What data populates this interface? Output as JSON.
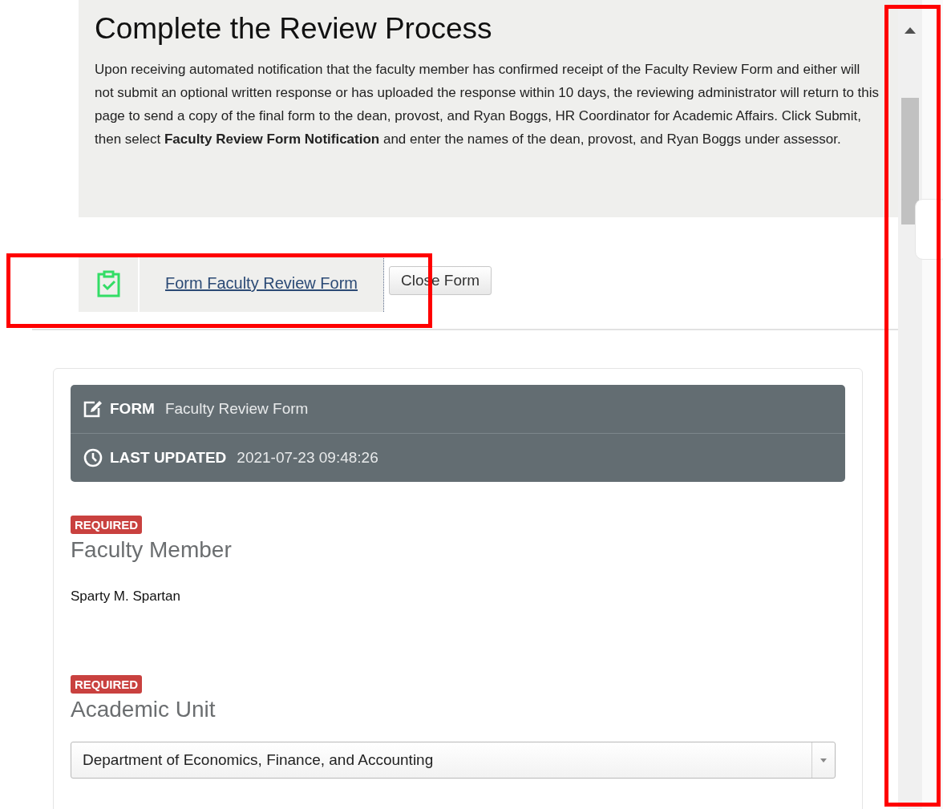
{
  "instructions": {
    "title": "Complete the Review Process",
    "text": "Upon receiving automated notification that the faculty member has confirmed receipt of the Faculty Review Form and either will not submit an optional written response or has uploaded the response within 10 days, the reviewing administrator will return to this page to send a copy of the final form to the dean, provost, and Ryan Boggs, HR Coordinator for Academic Affairs. Click Submit, then select **Faculty Review Form Notification** and enter the names of the dean, provost, and Ryan Boggs under assessor."
  },
  "form_bar": {
    "link": "Form Faculty Review Form",
    "button": "Close Form",
    "highlighted": true
  },
  "form_header": [
    {
      "kind": "form",
      "label": "FORM",
      "value": "Faculty Review Form"
    },
    {
      "kind": "updated",
      "label": "LAST UPDATED",
      "value": "2021-07-23 09:48:26"
    }
  ],
  "fields": [
    {
      "kind": "text",
      "badge": "REQUIRED",
      "label": "Faculty Member",
      "value": "Sparty M. Spartan"
    },
    {
      "kind": "select",
      "badge": "REQUIRED",
      "label": "Academic Unit",
      "value": "Department of Economics, Finance, and Accounting"
    }
  ],
  "scrollbar": {
    "highlighted": true
  }
}
